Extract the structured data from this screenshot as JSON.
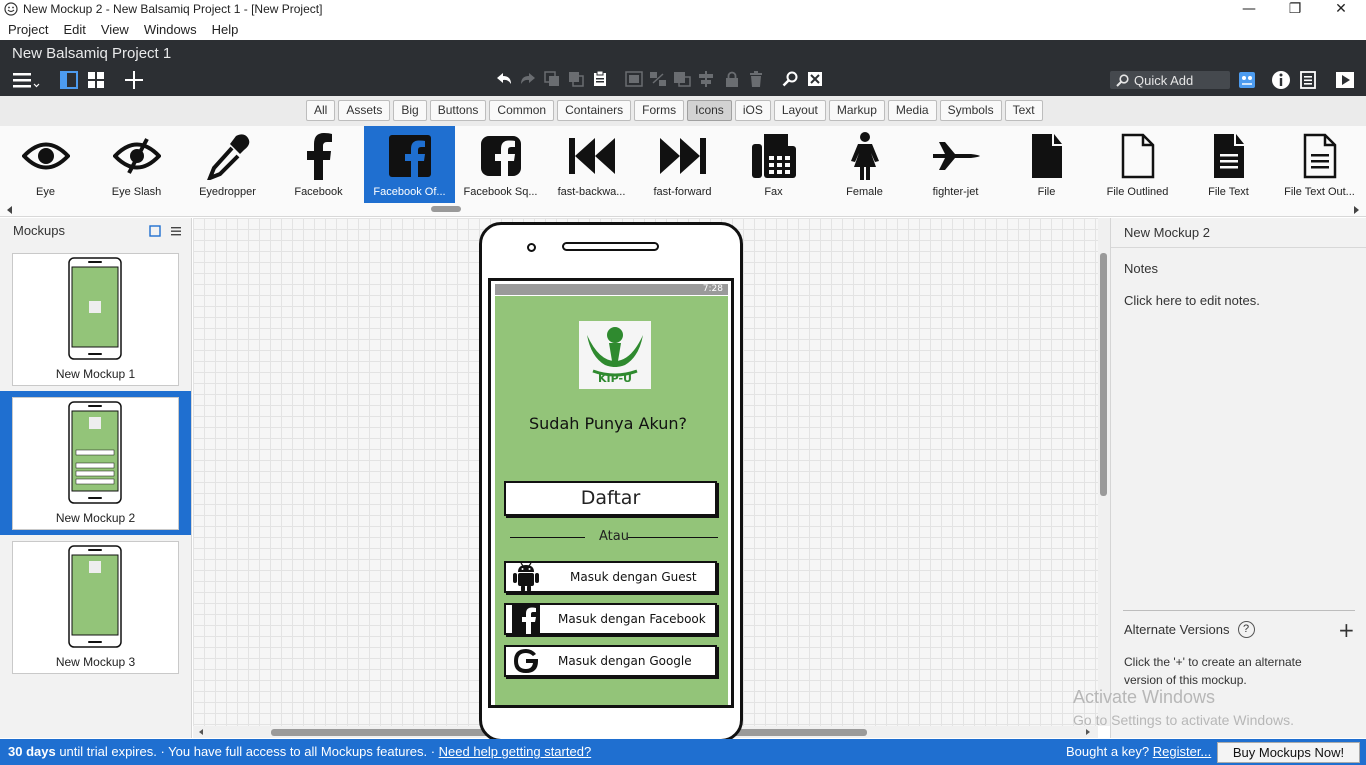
{
  "window": {
    "title": "New Mockup 2 - New Balsamiq Project 1 - [New Project]",
    "minimize": "—",
    "restore": "❐",
    "close": "✕"
  },
  "menu": [
    "Project",
    "Edit",
    "View",
    "Windows",
    "Help"
  ],
  "project_name": "New Balsamiq Project 1",
  "quick_add_placeholder": "Quick Add",
  "filters": [
    {
      "label": "All"
    },
    {
      "label": "Assets"
    },
    {
      "label": "Big"
    },
    {
      "label": "Buttons"
    },
    {
      "label": "Common"
    },
    {
      "label": "Containers"
    },
    {
      "label": "Forms"
    },
    {
      "label": "Icons",
      "active": true
    },
    {
      "label": "iOS"
    },
    {
      "label": "Layout"
    },
    {
      "label": "Markup"
    },
    {
      "label": "Media"
    },
    {
      "label": "Symbols"
    },
    {
      "label": "Text"
    }
  ],
  "library": [
    {
      "label": "Eye",
      "icon": "eye-icon"
    },
    {
      "label": "Eye Slash",
      "icon": "eye-slash-icon"
    },
    {
      "label": "Eyedropper",
      "icon": "eyedropper-icon"
    },
    {
      "label": "Facebook",
      "icon": "facebook-icon"
    },
    {
      "label": "Facebook Of...",
      "icon": "facebook-official-icon",
      "selected": true
    },
    {
      "label": "Facebook Sq...",
      "icon": "facebook-square-icon"
    },
    {
      "label": "fast-backwa...",
      "icon": "fast-backward-icon"
    },
    {
      "label": "fast-forward",
      "icon": "fast-forward-icon"
    },
    {
      "label": "Fax",
      "icon": "fax-icon"
    },
    {
      "label": "Female",
      "icon": "female-icon"
    },
    {
      "label": "fighter-jet",
      "icon": "fighter-jet-icon"
    },
    {
      "label": "File",
      "icon": "file-icon"
    },
    {
      "label": "File Outlined",
      "icon": "file-outlined-icon"
    },
    {
      "label": "File Text",
      "icon": "file-text-icon"
    },
    {
      "label": "File Text Out...",
      "icon": "file-text-outlined-icon"
    }
  ],
  "mockups_panel": {
    "title": "Mockups",
    "items": [
      {
        "label": "New Mockup 1"
      },
      {
        "label": "New Mockup 2",
        "selected": true
      },
      {
        "label": "New Mockup 3"
      }
    ]
  },
  "phone": {
    "status_time": "7:28",
    "logo_text": "KIP-U",
    "heading": "Sudah Punya Akun?",
    "primary_button": "Daftar",
    "separator": "Atau",
    "buttons": [
      {
        "label": "Masuk dengan Guest",
        "icon": "android-icon"
      },
      {
        "label": "Masuk dengan Facebook",
        "icon": "facebook-icon"
      },
      {
        "label": "Masuk dengan Google",
        "icon": "google-icon"
      }
    ],
    "screen_color": "#93c479"
  },
  "right_panel": {
    "title": "New Mockup 2",
    "notes_label": "Notes",
    "notes_placeholder": "Click here to edit notes.",
    "alt_versions_label": "Alternate Versions",
    "alt_help": "?",
    "alt_add": "+",
    "alt_description": "Click the '+' to create an alternate version of this mockup."
  },
  "watermark": {
    "line1": "Activate Windows",
    "line2": "Go to Settings to activate Windows."
  },
  "bottom_bar": {
    "trial_days": "30 days",
    "trial_text": " until trial expires. · You have full access to all Mockups features. · ",
    "help_link": "Need help getting started?",
    "key_text": "Bought a key? ",
    "register_link": "Register...",
    "buy_button": "Buy Mockups Now!"
  },
  "colors": {
    "accent": "#1f6fd0",
    "header_dark": "#2c2f33",
    "mockup_green": "#93c479"
  }
}
